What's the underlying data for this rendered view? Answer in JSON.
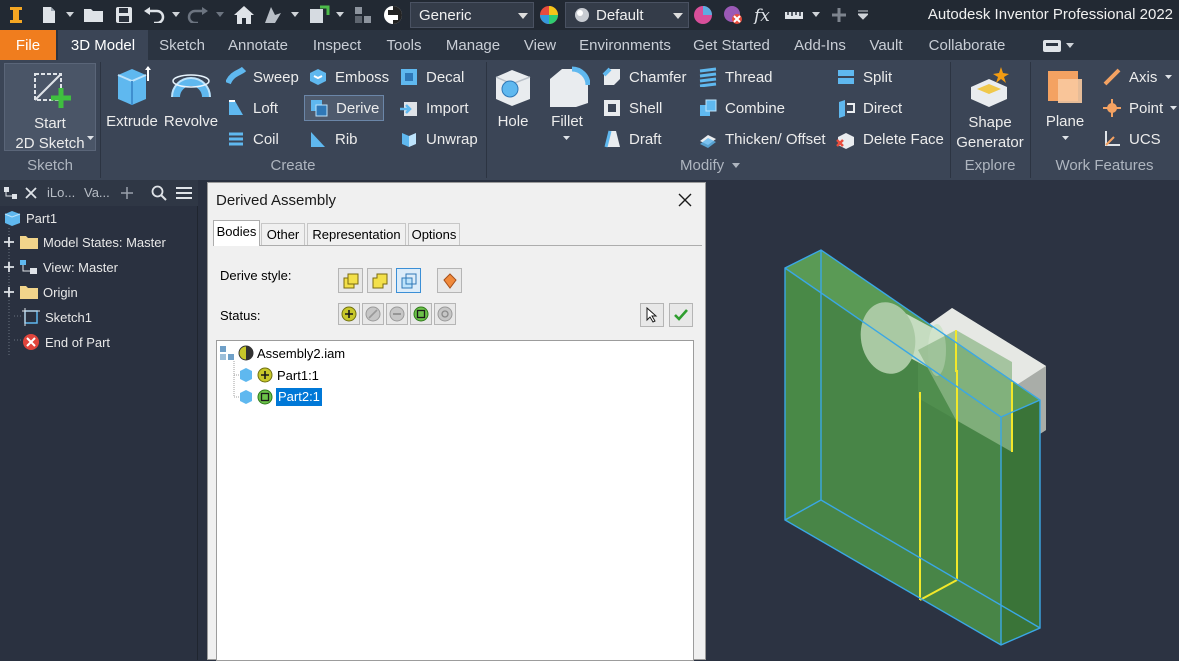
{
  "titlebar": {
    "app_title": "Autodesk Inventor Professional 2022",
    "material_combo": "Generic",
    "appearance_combo": "Default"
  },
  "tabs": [
    {
      "label": "File"
    },
    {
      "label": "3D Model"
    },
    {
      "label": "Sketch"
    },
    {
      "label": "Annotate"
    },
    {
      "label": "Inspect"
    },
    {
      "label": "Tools"
    },
    {
      "label": "Manage"
    },
    {
      "label": "View"
    },
    {
      "label": "Environments"
    },
    {
      "label": "Get Started"
    },
    {
      "label": "Add-Ins"
    },
    {
      "label": "Vault"
    },
    {
      "label": "Collaborate"
    }
  ],
  "ribbon": {
    "sketch": {
      "start_line1": "Start",
      "start_line2": "2D Sketch",
      "group": "Sketch"
    },
    "create": {
      "extrude": "Extrude",
      "revolve": "Revolve",
      "sweep": "Sweep",
      "loft": "Loft",
      "coil": "Coil",
      "emboss": "Emboss",
      "derive": "Derive",
      "rib": "Rib",
      "decal": "Decal",
      "import": "Import",
      "unwrap": "Unwrap",
      "group": "Create"
    },
    "modify": {
      "hole": "Hole",
      "fillet": "Fillet",
      "chamfer": "Chamfer",
      "shell": "Shell",
      "draft": "Draft",
      "thread": "Thread",
      "combine": "Combine",
      "thicken": "Thicken/ Offset",
      "split": "Split",
      "direct": "Direct",
      "delete_face": "Delete Face",
      "group": "Modify"
    },
    "explore": {
      "shape_line1": "Shape",
      "shape_line2": "Generator",
      "group": "Explore"
    },
    "work": {
      "plane": "Plane",
      "axis": "Axis",
      "point": "Point",
      "ucs": "UCS",
      "group": "Work Features"
    }
  },
  "browser": {
    "tab1": "iLo...",
    "tab2": "Va...",
    "items": [
      {
        "label": "Part1"
      },
      {
        "label": "Model States: Master"
      },
      {
        "label": "View: Master"
      },
      {
        "label": "Origin"
      },
      {
        "label": "Sketch1"
      },
      {
        "label": "End of Part"
      }
    ]
  },
  "dialog": {
    "title": "Derived Assembly",
    "tabs": [
      {
        "label": "Bodies"
      },
      {
        "label": "Other"
      },
      {
        "label": "Representation"
      },
      {
        "label": "Options"
      }
    ],
    "derive_style_label": "Derive style:",
    "status_label": "Status:",
    "tree": [
      {
        "label": "Assembly2.iam"
      },
      {
        "label": "Part1:1"
      },
      {
        "label": "Part2:1"
      }
    ]
  },
  "colors": {
    "file_tab": "#f07d1e",
    "ribbon_bg": "#3b4556",
    "selection": "#0078d7",
    "green_body": "#4a8a48",
    "edge_blue": "#3aa7e6"
  }
}
